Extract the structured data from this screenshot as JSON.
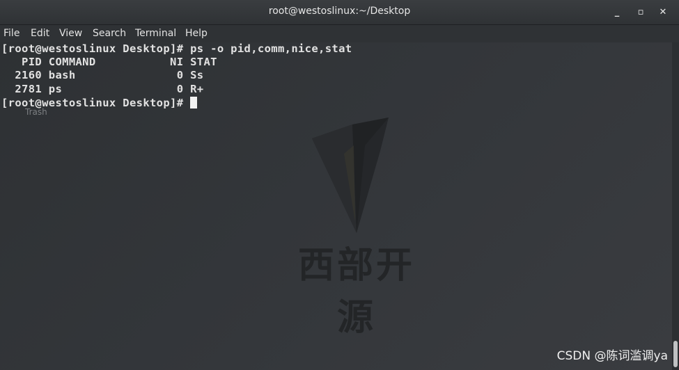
{
  "window": {
    "title": "root@westoslinux:~/Desktop",
    "minimize_label": "_",
    "maximize_label": "▫",
    "close_label": "✕"
  },
  "menu": {
    "items": [
      "File",
      "Edit",
      "View",
      "Search",
      "Terminal",
      "Help"
    ]
  },
  "terminal": {
    "lines": [
      "[root@westoslinux Desktop]# ps -o pid,comm,nice,stat",
      "   PID COMMAND           NI STAT",
      "  2160 bash               0 Ss",
      "  2781 ps                 0 R+",
      "[root@westoslinux Desktop]# "
    ],
    "desktop_label": "Trash"
  },
  "watermark": {
    "text": "西部开源"
  },
  "credit": {
    "text": "CSDN @陈词滥调ya"
  }
}
